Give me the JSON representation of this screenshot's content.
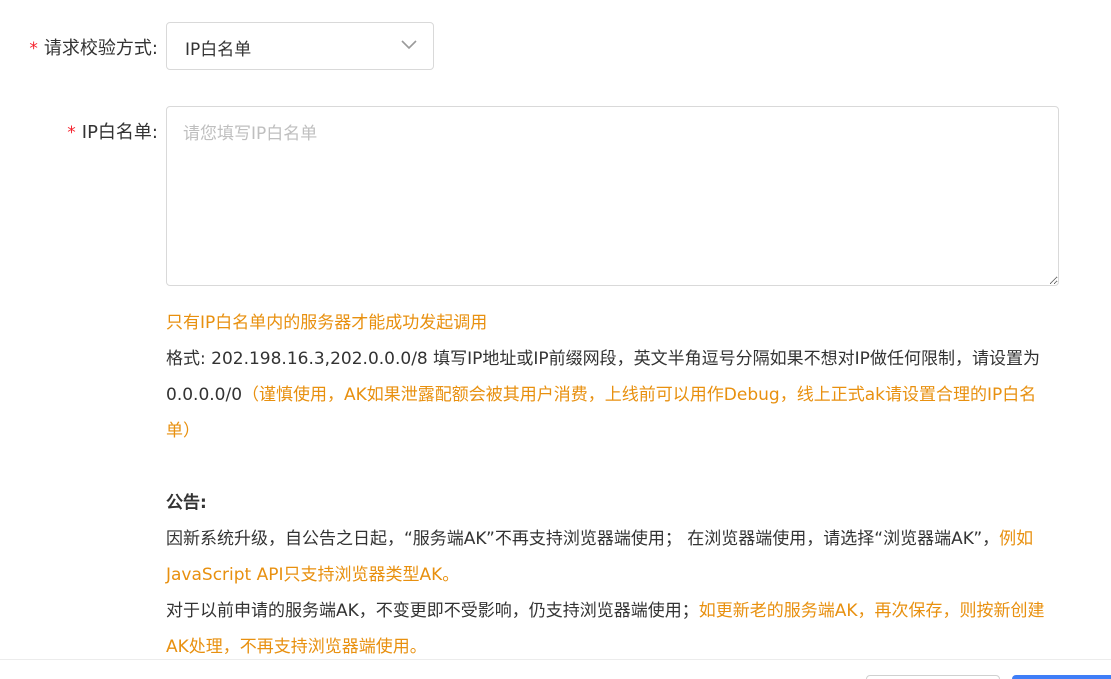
{
  "verify_method": {
    "label": "请求校验方式:",
    "required_mark": "*",
    "selected_value": "IP白名单",
    "icon": "chevron-down-icon"
  },
  "ip_whitelist": {
    "label": "IP白名单:",
    "required_mark": "*",
    "placeholder": "请您填写IP白名单",
    "value": ""
  },
  "help": {
    "line1": "只有IP白名单内的服务器才能成功发起调用",
    "format_text": "格式: 202.198.16.3,202.0.0.0/8 填写IP地址或IP前缀网段，英文半角逗号分隔如果不想对IP做任何限制，请设置为0.0.0.0/0",
    "format_warning": "（谨慎使用，AK如果泄露配额会被其用户消费，上线前可以用作Debug，线上正式ak请设置合理的IP白名单）"
  },
  "notice": {
    "title": "公告:",
    "p1_text": "因新系统升级，自公告之日起，“服务端AK”不再支持浏览器端使用； 在浏览器端使用，请选择“浏览器端AK”，",
    "p1_highlight": "例如JavaScript API只支持浏览器类型AK。",
    "p2_text": "对于以前申请的服务端AK，不变更即不受影响，仍支持浏览器端使用；",
    "p2_highlight": "如更新老的服务端AK，再次保存，则按新创建AK处理，不再支持浏览器端使用。"
  },
  "colors": {
    "required": "#f5222d",
    "warning": "#e8900f",
    "primary": "#3f7ef7",
    "border": "#d9d9d9"
  }
}
